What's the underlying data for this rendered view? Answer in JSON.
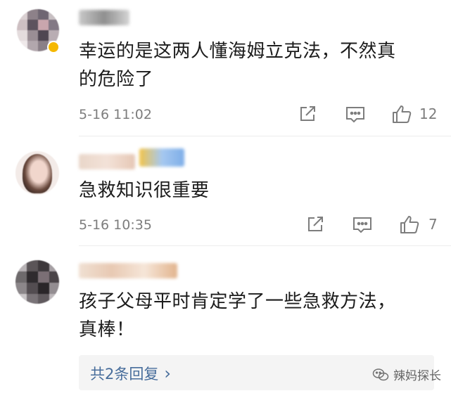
{
  "comments": [
    {
      "text_line1": "幸运的是这两人懂海姆立克法，不然真",
      "text_line2": "的危险了",
      "time": "5-16 11:02",
      "like_count": "12",
      "icons": [
        "share-icon",
        "comment-icon",
        "like-icon"
      ]
    },
    {
      "text_line1": "急救知识很重要",
      "time": "5-16 10:35",
      "like_count": "7",
      "icons": [
        "share-icon",
        "comment-icon",
        "like-icon"
      ]
    },
    {
      "text_line1": "孩子父母平时肯定学了一些急救方法，",
      "text_line2": "真棒！",
      "replies_label": "共2条回复",
      "replies_chevron": "›"
    }
  ],
  "watermark": {
    "text": "辣妈探长"
  },
  "colors": {
    "link": "#476d9b",
    "meta": "#7d7d7d",
    "badge": "#f5b800"
  }
}
